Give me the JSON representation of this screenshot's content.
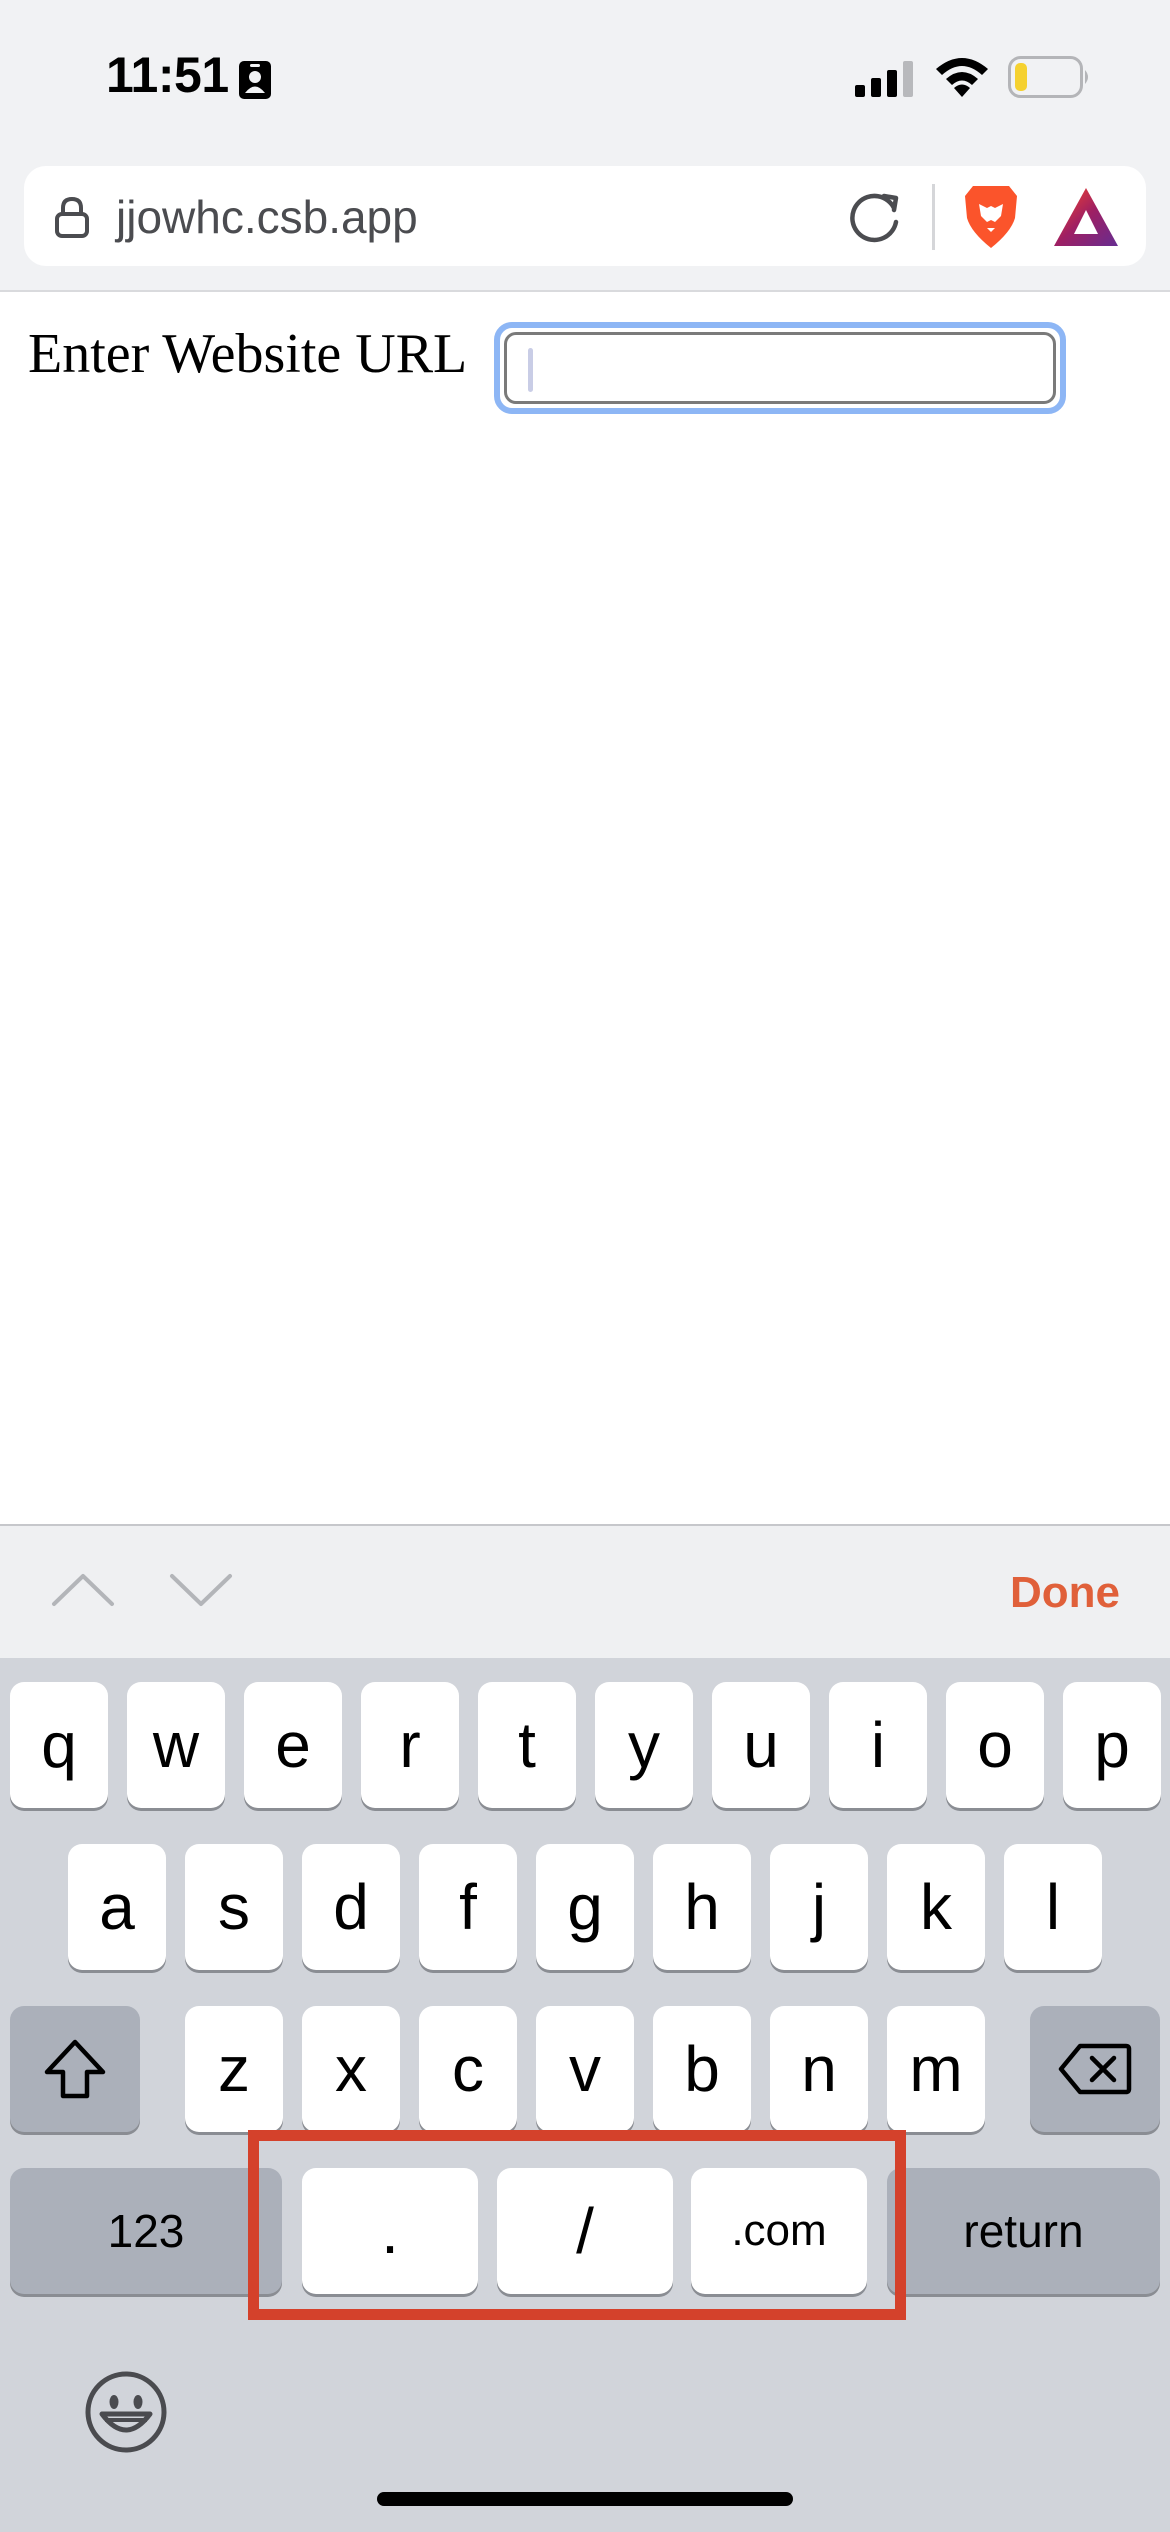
{
  "status_bar": {
    "time": "11:51",
    "icons": [
      "contact-card-icon",
      "cellular-signal-icon",
      "wifi-icon",
      "battery-low-icon"
    ],
    "battery_color": "#f5d130"
  },
  "browser": {
    "address": "jjowhc.csb.app",
    "icons": [
      "lock-icon",
      "reload-icon",
      "brave-lion-icon",
      "brave-rewards-icon"
    ],
    "brand_color": "#fb542b"
  },
  "page": {
    "label": "Enter Website URL",
    "input_value": "",
    "focus_color": "#8db6f5"
  },
  "accessory_bar": {
    "done_label": "Done",
    "done_color": "#e0603a"
  },
  "keyboard": {
    "row1": [
      "q",
      "w",
      "e",
      "r",
      "t",
      "y",
      "u",
      "i",
      "o",
      "p"
    ],
    "row2": [
      "a",
      "s",
      "d",
      "f",
      "g",
      "h",
      "j",
      "k",
      "l"
    ],
    "row3": [
      "z",
      "x",
      "c",
      "v",
      "b",
      "n",
      "m"
    ],
    "numbers_label": "123",
    "dot_label": ".",
    "slash_label": "/",
    "dotcom_label": ".com",
    "return_label": "return",
    "highlight_color": "#d4412b"
  }
}
